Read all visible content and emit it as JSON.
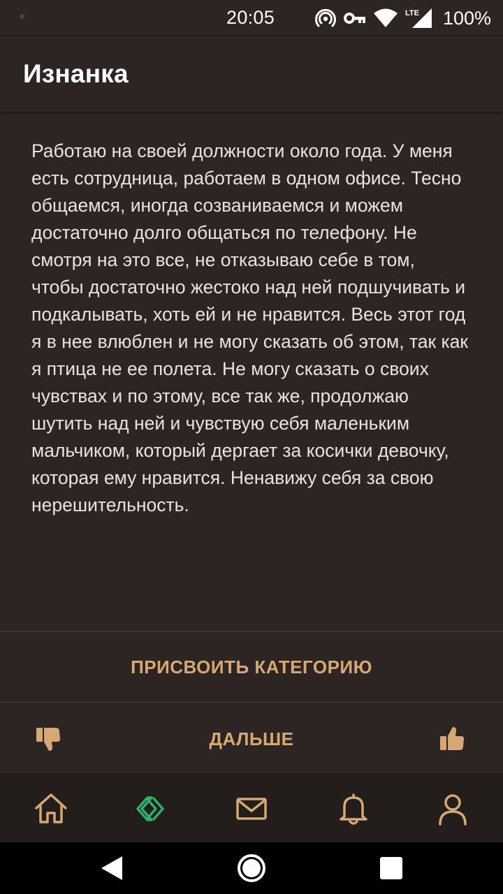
{
  "status_bar": {
    "time": "20:05",
    "battery": "100%",
    "network_type": "LTE",
    "icons": [
      "notification-dot",
      "hotspot-icon",
      "vpn-key-icon",
      "wifi-icon",
      "lte-signal-icon",
      "battery-icon"
    ]
  },
  "app_bar": {
    "title": "Изнанка"
  },
  "story": {
    "text": "Работаю на своей должности около года. У меня есть сотрудница, работаем в одном офисе. Тесно общаемся, иногда созваниваемся и можем достаточно долго общаться по телефону. Не смотря на это все, не отказываю себе в том, чтобы достаточно жестоко над ней подшучивать и подкалывать, хоть ей и не нравится. Весь этот год я в нее влюблен и не могу сказать об этом, так как я птица не ее полета. Не могу сказать о своих чувствах и по этому, все так же, продолжаю шутить над ней и чувствую себя маленьким мальчиком, который дергает за косички девочку, которая ему нравится. Ненавижу себя за свою нерешительность."
  },
  "actions": {
    "category_label": "ПРИСВОИТЬ КАТЕГОРИЮ",
    "next_label": "ДАЛЬШЕ",
    "dislike_icon": "thumbs-down-icon",
    "like_icon": "thumbs-up-icon"
  },
  "bottom_nav": {
    "items": [
      {
        "icon": "home-icon",
        "active": false
      },
      {
        "icon": "feed-chevrons-icon",
        "active": true
      },
      {
        "icon": "mail-icon",
        "active": false
      },
      {
        "icon": "bell-icon",
        "active": false
      },
      {
        "icon": "profile-icon",
        "active": false
      }
    ]
  },
  "system_nav": {
    "icons": [
      "back-icon",
      "home-circle-icon",
      "recents-icon"
    ]
  },
  "colors": {
    "background": "#2c2523",
    "accent": "#d6a874",
    "active_nav": "#2fb06a",
    "nav_background": "#231d1b"
  }
}
